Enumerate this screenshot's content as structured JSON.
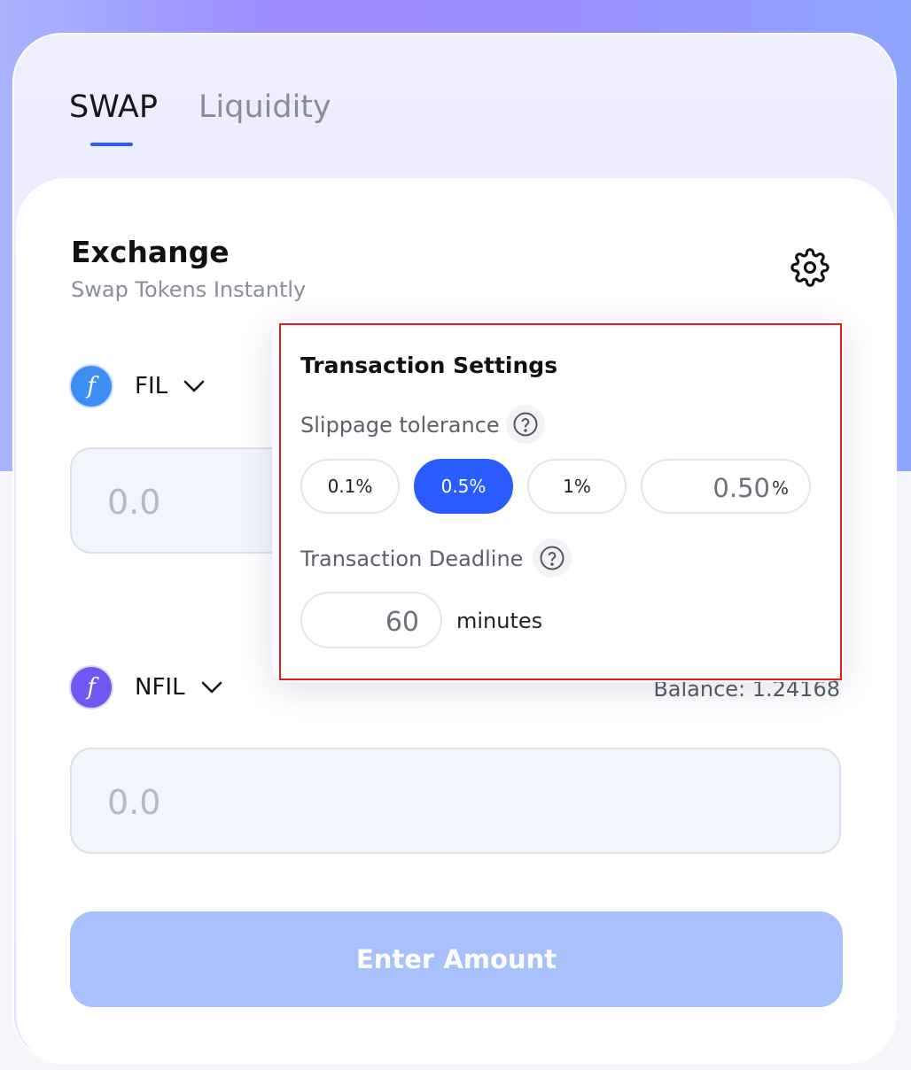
{
  "tabs": {
    "swap": "SWAP",
    "liquidity": "Liquidity"
  },
  "exchange": {
    "title": "Exchange",
    "subtitle": "Swap Tokens Instantly"
  },
  "from_token": {
    "symbol": "FIL",
    "amount_placeholder": "0.0",
    "logo_color": "#3e8ef5"
  },
  "to_token": {
    "symbol": "NFIL",
    "amount_placeholder": "0.0",
    "balance": "Balance: 1.24168",
    "logo_color": "#6f59f2"
  },
  "enter_button": "Enter Amount",
  "settings": {
    "title": "Transaction Settings",
    "slippage_label": "Slippage tolerance",
    "options": [
      "0.1%",
      "0.5%",
      "1%"
    ],
    "selected_option": "0.5%",
    "custom_value": "0.50",
    "custom_unit": "%",
    "deadline_label": "Transaction Deadline",
    "deadline_value": "60",
    "deadline_unit": "minutes"
  },
  "colors": {
    "accent": "#2a5bff",
    "button_disabled": "#a8c0fc",
    "highlight_border": "#e0201d"
  },
  "icons": {
    "settings": "gear-icon",
    "help": "question-circle-icon",
    "dropdown": "chevron-down-icon"
  }
}
